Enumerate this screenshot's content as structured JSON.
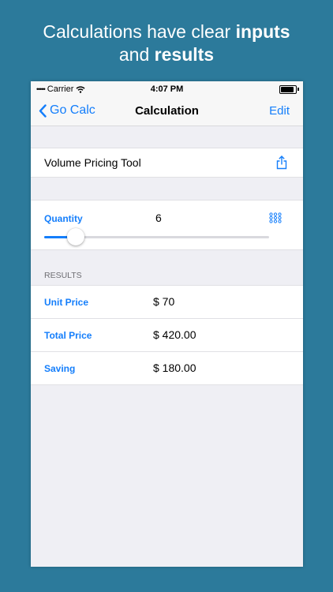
{
  "headline": {
    "line1_prefix": "Calculations have clear ",
    "line1_bold": "inputs",
    "line2_prefix": "and ",
    "line2_bold": "results"
  },
  "status_bar": {
    "carrier": "Carrier",
    "time": "4:07 PM"
  },
  "nav": {
    "back_label": "Go Calc",
    "title": "Calculation",
    "edit_label": "Edit"
  },
  "calculation": {
    "name": "Volume Pricing Tool"
  },
  "inputs": {
    "quantity_label": "Quantity",
    "quantity_value": "6",
    "slider_fraction": 0.14
  },
  "results": {
    "header": "RESULTS",
    "rows": [
      {
        "label": "Unit Price",
        "value": "$ 70"
      },
      {
        "label": "Total Price",
        "value": "$ 420.00"
      },
      {
        "label": "Saving",
        "value": "$ 180.00"
      }
    ]
  },
  "colors": {
    "background": "#2c7a9b",
    "accent": "#147efb"
  },
  "icons": {
    "back": "chevron-left-icon",
    "share": "share-icon",
    "keypad": "keypad-icon",
    "wifi": "wifi-icon",
    "battery": "battery-icon"
  }
}
